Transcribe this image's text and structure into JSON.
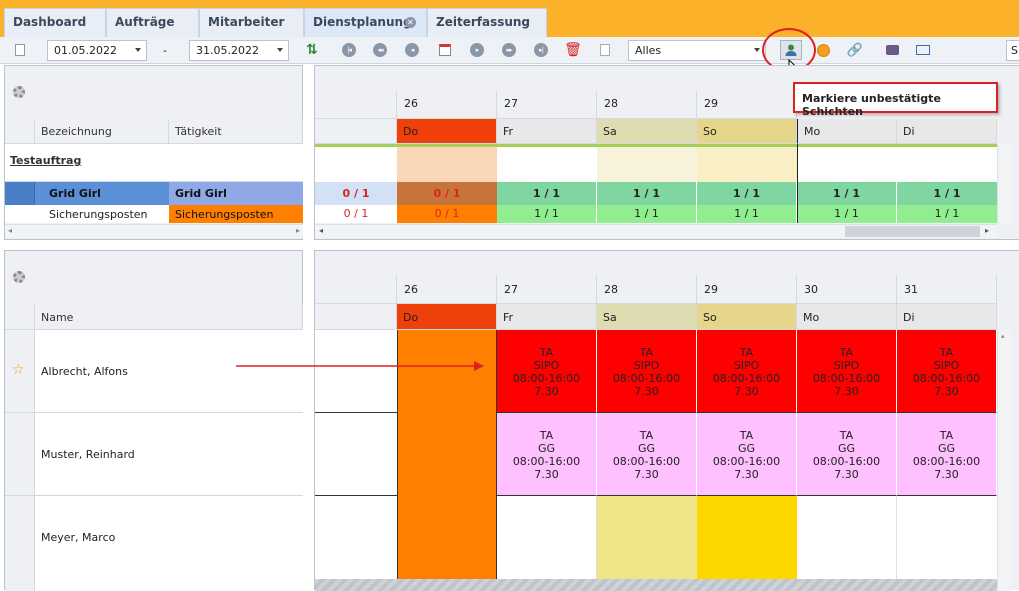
{
  "tabs": [
    {
      "label": "Dashboard"
    },
    {
      "label": "Aufträge"
    },
    {
      "label": "Mitarbeiter"
    },
    {
      "label": "Dienstplanung"
    },
    {
      "label": "Zeiterfassung"
    }
  ],
  "toolbar": {
    "date_from": "01.05.2022",
    "date_separator": "-",
    "date_to": "31.05.2022",
    "filter_value": "Alles",
    "cut_label": "S"
  },
  "tooltip": "Markiere unbestätigte Schichten",
  "top_panel": {
    "col_bezeichnung": "Bezeichnung",
    "col_taetigkeit": "Tätigkeit",
    "group": "Testauftrag",
    "rows": [
      {
        "name": "Grid Girl",
        "activity": "Grid Girl"
      },
      {
        "name": "Sicherungsposten",
        "activity": "Sicherungsposten"
      }
    ]
  },
  "top_calendar": {
    "days": [
      {
        "num": "26",
        "dow": "Do"
      },
      {
        "num": "27",
        "dow": "Fr"
      },
      {
        "num": "28",
        "dow": "Sa"
      },
      {
        "num": "29",
        "dow": "So"
      },
      {
        "num": "",
        "dow": "Mo"
      },
      {
        "num": "",
        "dow": "Di"
      }
    ],
    "row1_total": "0 / 1",
    "row1": [
      "0 / 1",
      "1 / 1",
      "1 / 1",
      "1 / 1",
      "1 / 1",
      "1 / 1"
    ],
    "row2_total": "0 / 1",
    "row2": [
      "0 / 1",
      "1 / 1",
      "1 / 1",
      "1 / 1",
      "1 / 1",
      "1 / 1"
    ]
  },
  "bottom_panel": {
    "col_name": "Name",
    "employees": [
      {
        "name": "Albrecht, Alfons"
      },
      {
        "name": "Muster, Reinhard"
      },
      {
        "name": "Meyer, Marco"
      }
    ]
  },
  "bottom_calendar": {
    "days": [
      {
        "num": "26",
        "dow": "Do"
      },
      {
        "num": "27",
        "dow": "Fr"
      },
      {
        "num": "28",
        "dow": "Sa"
      },
      {
        "num": "29",
        "dow": "So"
      },
      {
        "num": "30",
        "dow": "Mo"
      },
      {
        "num": "31",
        "dow": "Di"
      }
    ],
    "shift_a": {
      "l1": "TA",
      "l2": "SIPO",
      "l3": "08:00-16:00",
      "l4": "7.30"
    },
    "shift_b": {
      "l1": "TA",
      "l2": "GG",
      "l3": "08:00-16:00",
      "l4": "7.30"
    }
  },
  "colors": {
    "accent": "#fbb12a",
    "do_header": "#f0400a",
    "red_shift": "#ff0000",
    "pink_shift": "#ffc0ff",
    "orange_col": "#ff7f00",
    "green_ok": "#7fd6a0",
    "callout": "#e02020"
  }
}
